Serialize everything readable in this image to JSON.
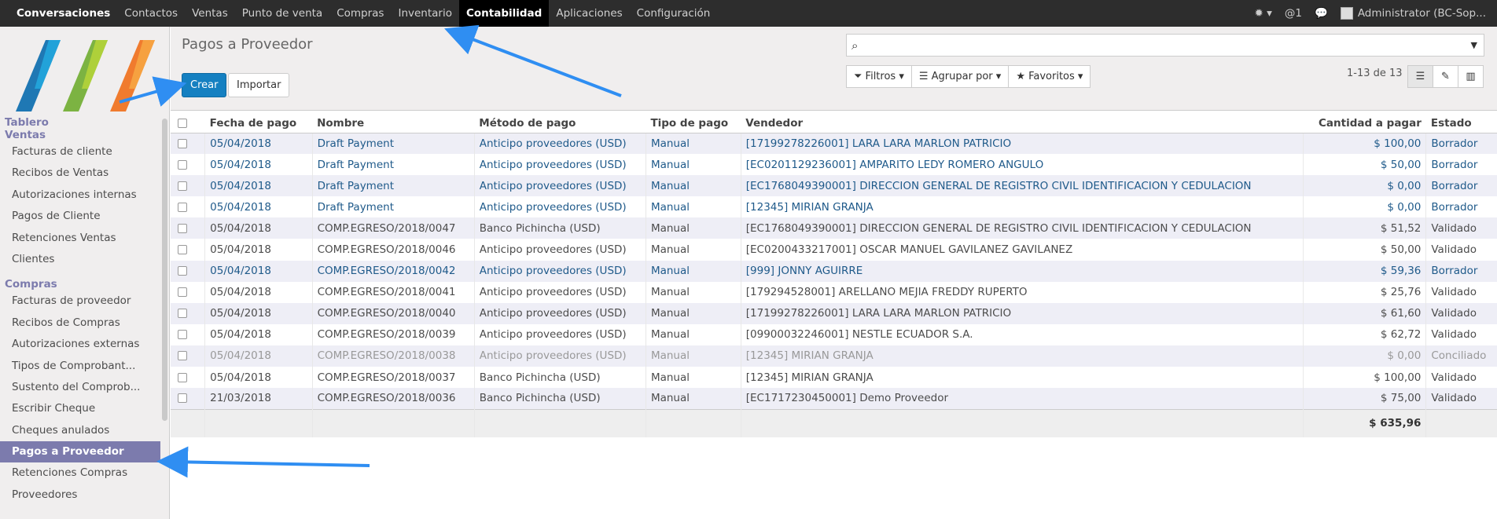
{
  "topbar": {
    "menu": [
      {
        "label": "Conversaciones",
        "name": "menu-conversaciones",
        "style": "brand"
      },
      {
        "label": "Contactos",
        "name": "menu-contactos",
        "style": ""
      },
      {
        "label": "Ventas",
        "name": "menu-ventas",
        "style": ""
      },
      {
        "label": "Punto de venta",
        "name": "menu-punto-de-venta",
        "style": ""
      },
      {
        "label": "Compras",
        "name": "menu-compras",
        "style": ""
      },
      {
        "label": "Inventario",
        "name": "menu-inventario",
        "style": ""
      },
      {
        "label": "Contabilidad",
        "name": "menu-contabilidad",
        "style": "active"
      },
      {
        "label": "Aplicaciones",
        "name": "menu-aplicaciones",
        "style": ""
      },
      {
        "label": "Configuración",
        "name": "menu-configuracion",
        "style": ""
      }
    ],
    "mentions": "1",
    "user": "Administrator (BC-Sop..."
  },
  "sidebar": {
    "sections": [
      {
        "title": "Tablero",
        "items": []
      },
      {
        "title": "Ventas",
        "items": [
          "Facturas de cliente",
          "Recibos de Ventas",
          "Autorizaciones internas",
          "Pagos de Cliente",
          "Retenciones Ventas",
          "Clientes"
        ]
      },
      {
        "title": "Compras",
        "items": [
          "Facturas de proveedor",
          "Recibos de Compras",
          "Autorizaciones externas",
          "Tipos de Comprobant...",
          "Sustento del Comprob...",
          "Escribir Cheque",
          "Cheques anulados",
          "Pagos a Proveedor",
          "Retenciones Compras",
          "Proveedores"
        ]
      }
    ],
    "active_item": "Pagos a Proveedor"
  },
  "control_panel": {
    "title": "Pagos a Proveedor",
    "create_label": "Crear",
    "import_label": "Importar",
    "search_value": "",
    "filters_label": "Filtros",
    "groupby_label": "Agrupar por",
    "favorites_label": "Favoritos",
    "pager": "1-13 de 13"
  },
  "table": {
    "columns": [
      "Fecha de pago",
      "Nombre",
      "Método de pago",
      "Tipo de pago",
      "Vendedor",
      "Cantidad a pagar",
      "Estado"
    ],
    "rows": [
      {
        "date": "05/04/2018",
        "name": "Draft Payment",
        "method": "Anticipo proveedores (USD)",
        "type": "Manual",
        "vendor": "[17199278226001] LARA LARA MARLON PATRICIO",
        "amount": "$ 100,00",
        "state": "Borrador",
        "status": "draft"
      },
      {
        "date": "05/04/2018",
        "name": "Draft Payment",
        "method": "Anticipo proveedores (USD)",
        "type": "Manual",
        "vendor": "[EC0201129236001] AMPARITO LEDY ROMERO ANGULO",
        "amount": "$ 50,00",
        "state": "Borrador",
        "status": "draft"
      },
      {
        "date": "05/04/2018",
        "name": "Draft Payment",
        "method": "Anticipo proveedores (USD)",
        "type": "Manual",
        "vendor": "[EC1768049390001] DIRECCION GENERAL DE REGISTRO CIVIL IDENTIFICACION Y CEDULACION",
        "amount": "$ 0,00",
        "state": "Borrador",
        "status": "draft"
      },
      {
        "date": "05/04/2018",
        "name": "Draft Payment",
        "method": "Anticipo proveedores (USD)",
        "type": "Manual",
        "vendor": "[12345] MIRIAN GRANJA",
        "amount": "$ 0,00",
        "state": "Borrador",
        "status": "draft"
      },
      {
        "date": "05/04/2018",
        "name": "COMP.EGRESO/2018/0047",
        "method": "Banco Pichincha (USD)",
        "type": "Manual",
        "vendor": "[EC1768049390001] DIRECCION GENERAL DE REGISTRO CIVIL IDENTIFICACION Y CEDULACION",
        "amount": "$ 51,52",
        "state": "Validado",
        "status": "posted"
      },
      {
        "date": "05/04/2018",
        "name": "COMP.EGRESO/2018/0046",
        "method": "Anticipo proveedores (USD)",
        "type": "Manual",
        "vendor": "[EC0200433217001] OSCAR MANUEL GAVILANEZ GAVILANEZ",
        "amount": "$ 50,00",
        "state": "Validado",
        "status": "posted"
      },
      {
        "date": "05/04/2018",
        "name": "COMP.EGRESO/2018/0042",
        "method": "Anticipo proveedores (USD)",
        "type": "Manual",
        "vendor": "[999] JONNY AGUIRRE",
        "amount": "$ 59,36",
        "state": "Borrador",
        "status": "draft"
      },
      {
        "date": "05/04/2018",
        "name": "COMP.EGRESO/2018/0041",
        "method": "Anticipo proveedores (USD)",
        "type": "Manual",
        "vendor": "[179294528001] ARELLANO MEJIA FREDDY RUPERTO",
        "amount": "$ 25,76",
        "state": "Validado",
        "status": "posted"
      },
      {
        "date": "05/04/2018",
        "name": "COMP.EGRESO/2018/0040",
        "method": "Anticipo proveedores (USD)",
        "type": "Manual",
        "vendor": "[17199278226001] LARA LARA MARLON PATRICIO",
        "amount": "$ 61,60",
        "state": "Validado",
        "status": "posted"
      },
      {
        "date": "05/04/2018",
        "name": "COMP.EGRESO/2018/0039",
        "method": "Anticipo proveedores (USD)",
        "type": "Manual",
        "vendor": "[09900032246001] NESTLE ECUADOR S.A.",
        "amount": "$ 62,72",
        "state": "Validado",
        "status": "posted"
      },
      {
        "date": "05/04/2018",
        "name": "COMP.EGRESO/2018/0038",
        "method": "Anticipo proveedores (USD)",
        "type": "Manual",
        "vendor": "[12345] MIRIAN GRANJA",
        "amount": "$ 0,00",
        "state": "Conciliado",
        "status": "reconciled"
      },
      {
        "date": "05/04/2018",
        "name": "COMP.EGRESO/2018/0037",
        "method": "Banco Pichincha (USD)",
        "type": "Manual",
        "vendor": "[12345] MIRIAN GRANJA",
        "amount": "$ 100,00",
        "state": "Validado",
        "status": "posted"
      },
      {
        "date": "21/03/2018",
        "name": "COMP.EGRESO/2018/0036",
        "method": "Banco Pichincha (USD)",
        "type": "Manual",
        "vendor": "[EC1717230450001] Demo Proveedor",
        "amount": "$ 75,00",
        "state": "Validado",
        "status": "posted"
      }
    ],
    "total": "$ 635,96"
  },
  "colors": {
    "accent": "#1580c1",
    "sidebar_active": "#7c7bad",
    "draft_text": "#1f5a8a",
    "annotation_arrow": "#2f8ef2"
  }
}
